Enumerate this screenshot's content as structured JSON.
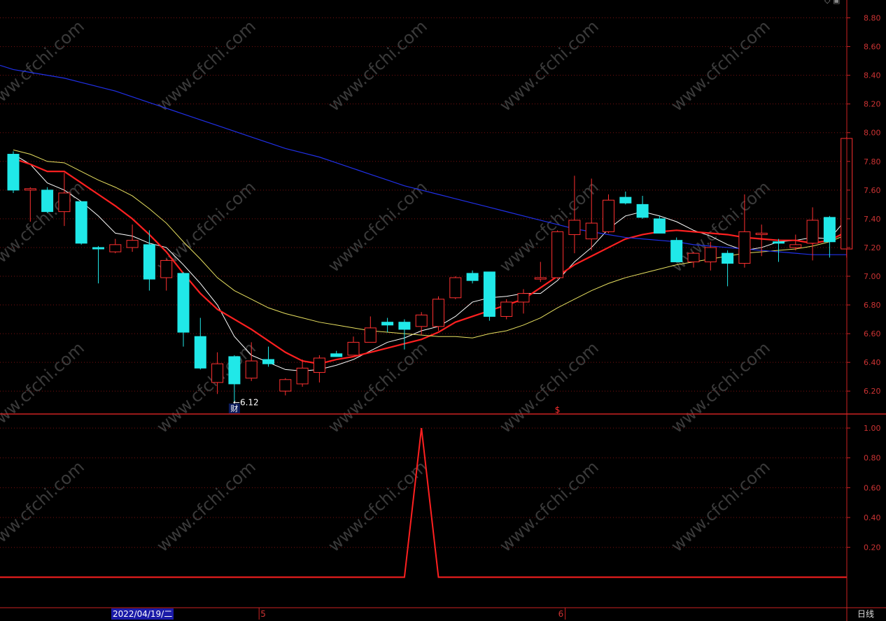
{
  "chart_data": [
    {
      "type": "candlestick",
      "y_axis": {
        "ticks": [
          "8.80",
          "8.60",
          "8.40",
          "8.20",
          "8.00",
          "7.80",
          "7.60",
          "7.40",
          "7.20",
          "7.00",
          "6.80",
          "6.60",
          "6.40",
          "6.20"
        ],
        "ylim": [
          6.05,
          8.9
        ],
        "grid": "horizontal dotted"
      },
      "candles": [
        {
          "o": 7.85,
          "h": 7.87,
          "l": 7.58,
          "c": 7.6,
          "up": false
        },
        {
          "o": 7.6,
          "h": 7.62,
          "l": 7.38,
          "c": 7.61,
          "up": true
        },
        {
          "o": 7.6,
          "h": 7.62,
          "l": 7.44,
          "c": 7.45,
          "up": false
        },
        {
          "o": 7.45,
          "h": 7.72,
          "l": 7.35,
          "c": 7.58,
          "up": true
        },
        {
          "o": 7.52,
          "h": 7.52,
          "l": 7.22,
          "c": 7.23,
          "up": false
        },
        {
          "o": 7.2,
          "h": 7.21,
          "l": 6.95,
          "c": 7.19,
          "up": false
        },
        {
          "o": 7.17,
          "h": 7.26,
          "l": 7.16,
          "c": 7.22,
          "up": true
        },
        {
          "o": 7.2,
          "h": 7.36,
          "l": 7.17,
          "c": 7.25,
          "up": true
        },
        {
          "o": 7.22,
          "h": 7.32,
          "l": 6.9,
          "c": 6.98,
          "up": false
        },
        {
          "o": 6.99,
          "h": 7.12,
          "l": 6.9,
          "c": 7.11,
          "up": true
        },
        {
          "o": 7.02,
          "h": 7.03,
          "l": 6.51,
          "c": 6.61,
          "up": false
        },
        {
          "o": 6.58,
          "h": 6.71,
          "l": 6.35,
          "c": 6.36,
          "up": false
        },
        {
          "o": 6.26,
          "h": 6.47,
          "l": 6.18,
          "c": 6.39,
          "up": true
        },
        {
          "o": 6.44,
          "h": 6.45,
          "l": 6.12,
          "c": 6.25,
          "up": false
        },
        {
          "o": 6.29,
          "h": 6.54,
          "l": 6.27,
          "c": 6.41,
          "up": true
        },
        {
          "o": 6.42,
          "h": 6.51,
          "l": 6.37,
          "c": 6.39,
          "up": false
        },
        {
          "o": 6.2,
          "h": 6.29,
          "l": 6.17,
          "c": 6.28,
          "up": true
        },
        {
          "o": 6.25,
          "h": 6.42,
          "l": 6.23,
          "c": 6.36,
          "up": true
        },
        {
          "o": 6.33,
          "h": 6.45,
          "l": 6.26,
          "c": 6.43,
          "up": true
        },
        {
          "o": 6.46,
          "h": 6.48,
          "l": 6.44,
          "c": 6.44,
          "up": false
        },
        {
          "o": 6.45,
          "h": 6.58,
          "l": 6.45,
          "c": 6.54,
          "up": true
        },
        {
          "o": 6.54,
          "h": 6.72,
          "l": 6.54,
          "c": 6.64,
          "up": true
        },
        {
          "o": 6.68,
          "h": 6.71,
          "l": 6.61,
          "c": 6.66,
          "up": false
        },
        {
          "o": 6.68,
          "h": 6.7,
          "l": 6.49,
          "c": 6.63,
          "up": false
        },
        {
          "o": 6.65,
          "h": 6.75,
          "l": 6.59,
          "c": 6.73,
          "up": true
        },
        {
          "o": 6.65,
          "h": 6.86,
          "l": 6.62,
          "c": 6.84,
          "up": true
        },
        {
          "o": 6.85,
          "h": 7.0,
          "l": 6.84,
          "c": 6.99,
          "up": true
        },
        {
          "o": 7.02,
          "h": 7.04,
          "l": 6.95,
          "c": 6.97,
          "up": false
        },
        {
          "o": 7.03,
          "h": 7.03,
          "l": 6.69,
          "c": 6.72,
          "up": false
        },
        {
          "o": 6.72,
          "h": 6.84,
          "l": 6.7,
          "c": 6.82,
          "up": true
        },
        {
          "o": 6.82,
          "h": 6.91,
          "l": 6.74,
          "c": 6.88,
          "up": true
        },
        {
          "o": 6.98,
          "h": 7.1,
          "l": 6.96,
          "c": 6.99,
          "up": true
        },
        {
          "o": 6.99,
          "h": 7.32,
          "l": 6.98,
          "c": 7.31,
          "up": true
        },
        {
          "o": 7.29,
          "h": 7.7,
          "l": 7.16,
          "c": 7.39,
          "up": true
        },
        {
          "o": 7.26,
          "h": 7.68,
          "l": 7.18,
          "c": 7.37,
          "up": true
        },
        {
          "o": 7.31,
          "h": 7.57,
          "l": 7.3,
          "c": 7.53,
          "up": true
        },
        {
          "o": 7.55,
          "h": 7.59,
          "l": 7.5,
          "c": 7.51,
          "up": false
        },
        {
          "o": 7.5,
          "h": 7.56,
          "l": 7.4,
          "c": 7.41,
          "up": false
        },
        {
          "o": 7.4,
          "h": 7.42,
          "l": 7.3,
          "c": 7.3,
          "up": false
        },
        {
          "o": 7.25,
          "h": 7.27,
          "l": 7.1,
          "c": 7.1,
          "up": false
        },
        {
          "o": 7.1,
          "h": 7.17,
          "l": 7.06,
          "c": 7.16,
          "up": true
        },
        {
          "o": 7.1,
          "h": 7.24,
          "l": 7.04,
          "c": 7.2,
          "up": true
        },
        {
          "o": 7.16,
          "h": 7.18,
          "l": 6.93,
          "c": 7.09,
          "up": false
        },
        {
          "o": 7.09,
          "h": 7.57,
          "l": 7.06,
          "c": 7.31,
          "up": true
        },
        {
          "o": 7.29,
          "h": 7.36,
          "l": 7.14,
          "c": 7.3,
          "up": true
        },
        {
          "o": 7.24,
          "h": 7.26,
          "l": 7.1,
          "c": 7.23,
          "up": false
        },
        {
          "o": 7.22,
          "h": 7.29,
          "l": 7.18,
          "c": 7.2,
          "up": true
        },
        {
          "o": 7.23,
          "h": 7.48,
          "l": 7.11,
          "c": 7.39,
          "up": true
        },
        {
          "o": 7.41,
          "h": 7.42,
          "l": 7.13,
          "c": 7.24,
          "up": false
        },
        {
          "o": 7.19,
          "h": 7.97,
          "l": 7.13,
          "c": 7.96,
          "up": true
        }
      ],
      "series": [
        {
          "color": "#ffffff",
          "values": [
            7.85,
            7.78,
            7.65,
            7.6,
            7.52,
            7.42,
            7.3,
            7.28,
            7.23,
            7.2,
            7.08,
            6.95,
            6.8,
            6.58,
            6.45,
            6.4,
            6.35,
            6.34,
            6.35,
            6.38,
            6.42,
            6.48,
            6.54,
            6.57,
            6.62,
            6.65,
            6.72,
            6.82,
            6.85,
            6.86,
            6.88,
            6.88,
            6.97,
            7.1,
            7.2,
            7.33,
            7.42,
            7.45,
            7.42,
            7.38,
            7.32,
            7.28,
            7.22,
            7.18,
            7.2,
            7.24,
            7.25,
            7.27,
            7.26,
            7.4
          ]
        },
        {
          "color": "#ff2020",
          "values": [
            7.82,
            7.78,
            7.73,
            7.73,
            7.65,
            7.57,
            7.49,
            7.4,
            7.29,
            7.17,
            7.02,
            6.88,
            6.77,
            6.7,
            6.63,
            6.55,
            6.47,
            6.41,
            6.39,
            6.42,
            6.44,
            6.47,
            6.5,
            6.53,
            6.56,
            6.61,
            6.68,
            6.72,
            6.76,
            6.8,
            6.84,
            6.92,
            7.0,
            7.08,
            7.14,
            7.2,
            7.26,
            7.29,
            7.31,
            7.32,
            7.31,
            7.3,
            7.29,
            7.27,
            7.26,
            7.25,
            7.25,
            7.23,
            7.25,
            7.31
          ]
        },
        {
          "color": "#e8e060",
          "values": [
            7.88,
            7.85,
            7.8,
            7.79,
            7.73,
            7.67,
            7.62,
            7.56,
            7.47,
            7.37,
            7.24,
            7.12,
            6.99,
            6.9,
            6.84,
            6.78,
            6.74,
            6.71,
            6.68,
            6.66,
            6.64,
            6.62,
            6.61,
            6.6,
            6.59,
            6.58,
            6.58,
            6.57,
            6.6,
            6.62,
            6.66,
            6.71,
            6.78,
            6.84,
            6.9,
            6.95,
            6.99,
            7.02,
            7.05,
            7.08,
            7.1,
            7.12,
            7.14,
            7.16,
            7.17,
            7.18,
            7.19,
            7.21,
            7.24,
            7.29
          ]
        },
        {
          "color": "#2030e8",
          "values": [
            8.44,
            8.42,
            8.4,
            8.38,
            8.35,
            8.32,
            8.29,
            8.25,
            8.21,
            8.17,
            8.13,
            8.09,
            8.05,
            8.01,
            7.97,
            7.93,
            7.89,
            7.86,
            7.83,
            7.79,
            7.75,
            7.71,
            7.67,
            7.63,
            7.6,
            7.57,
            7.54,
            7.51,
            7.48,
            7.45,
            7.42,
            7.39,
            7.36,
            7.33,
            7.31,
            7.29,
            7.27,
            7.26,
            7.25,
            7.24,
            7.22,
            7.21,
            7.2,
            7.19,
            7.18,
            7.17,
            7.16,
            7.15,
            7.15,
            7.15
          ]
        }
      ],
      "annotations": [
        {
          "text": "←6.12",
          "at_candle": 13,
          "price": 6.12
        },
        {
          "text": "财",
          "at_candle": 13
        },
        {
          "text": "$",
          "at_candle": 32
        }
      ]
    },
    {
      "type": "line",
      "y_axis": {
        "ticks": [
          "1.00",
          "0.80",
          "0.60",
          "0.40",
          "0.20"
        ],
        "ylim": [
          -0.2,
          1.08
        ],
        "grid": "horizontal dotted"
      },
      "series": [
        {
          "color": "#ff2020",
          "values": [
            0,
            0,
            0,
            0,
            0,
            0,
            0,
            0,
            0,
            0,
            0,
            0,
            0,
            0,
            0,
            0,
            0,
            0,
            0,
            0,
            0,
            0,
            0,
            0,
            1,
            0,
            0,
            0,
            0,
            0,
            0,
            0,
            0,
            0,
            0,
            0,
            0,
            0,
            0,
            0,
            0,
            0,
            0,
            0,
            0,
            0,
            0,
            0,
            0,
            0
          ]
        }
      ]
    }
  ],
  "x_axis": {
    "date_cursor": "2022/04/19/二",
    "month_labels": [
      {
        "text": "5",
        "at_candle": 14
      },
      {
        "text": "6",
        "at_candle": 32
      }
    ]
  },
  "period_label": "日线",
  "watermark": "www.cfchi.com",
  "colors": {
    "up": "#ff3030",
    "down": "#20e8e8",
    "grid": "#7a1010",
    "axis": "#cc2222",
    "tick_text": "#cc3333"
  }
}
